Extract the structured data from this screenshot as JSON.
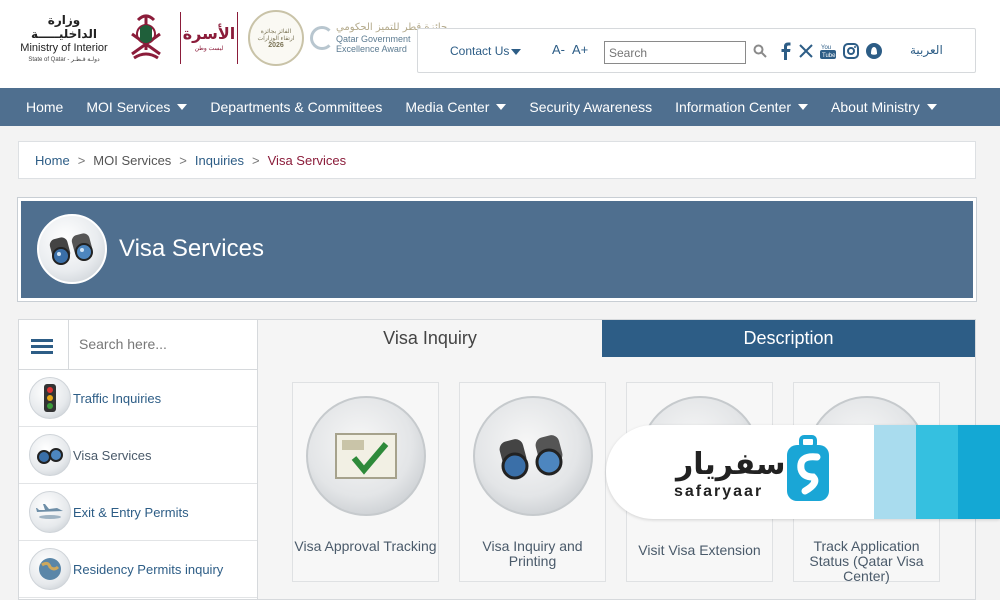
{
  "header": {
    "moi_arabic": "وزارة الداخليـــــة",
    "moi_english": "Ministry of Interior",
    "moi_state": "State of Qatar - دولـة قـطـر",
    "vision_arabic": "الأسرة",
    "vision_sub": "ليست وطن",
    "award_badge_line1": "الفائز بجائزة",
    "award_badge_line2": "ارتقاء الوزارات",
    "award_badge_year": "2026",
    "qgea_arabic": "جائزة قطر للتميز الحكومي",
    "qgea_english_1": "Qatar Government",
    "qgea_english_2": "Excellence Award"
  },
  "topbar": {
    "contact_label": "Contact Us",
    "font_decrease": "A-",
    "font_increase": "A+",
    "search_placeholder": "Search",
    "arabic_label": "العربية",
    "social_icons": [
      "facebook-icon",
      "x-icon",
      "youtube-icon",
      "instagram-icon",
      "snapchat-icon"
    ]
  },
  "nav": {
    "items": [
      {
        "label": "Home",
        "dropdown": false
      },
      {
        "label": "MOI Services",
        "dropdown": true
      },
      {
        "label": "Departments & Committees",
        "dropdown": false
      },
      {
        "label": "Media Center",
        "dropdown": true
      },
      {
        "label": "Security Awareness",
        "dropdown": false
      },
      {
        "label": "Information Center",
        "dropdown": true
      },
      {
        "label": "About Ministry",
        "dropdown": true
      }
    ]
  },
  "breadcrumb": {
    "home": "Home",
    "sep": ">",
    "moi_services": "MOI Services",
    "inquiries": "Inquiries",
    "current": "Visa Services"
  },
  "banner": {
    "title": "Visa Services",
    "icon": "binoculars-icon"
  },
  "sidebar": {
    "search_placeholder": "Search here...",
    "items": [
      {
        "label": "Traffic Inquiries",
        "icon": "traffic-light-icon"
      },
      {
        "label": "Visa Services",
        "icon": "binoculars-icon"
      },
      {
        "label": "Exit & Entry Permits",
        "icon": "airplane-icon"
      },
      {
        "label": "Residency Permits inquiry",
        "icon": "globe-icon"
      }
    ]
  },
  "tabs": {
    "left": "Visa Inquiry",
    "right": "Description"
  },
  "cards": [
    {
      "label": "Visa Approval Tracking",
      "icon": "checkmark-document-icon"
    },
    {
      "label": "Visa Inquiry and Printing",
      "icon": "binoculars-icon"
    },
    {
      "label": "Visit Visa Extension",
      "icon": "visa-extension-icon"
    },
    {
      "label": "Track Application Status (Qatar Visa Center)",
      "icon": "track-status-icon"
    }
  ],
  "ad": {
    "arabic": "سفريار",
    "english": "safaryaar",
    "colors": [
      "#a9dcee",
      "#35c0e0",
      "#14a8d4"
    ]
  },
  "colors": {
    "nav_bg": "#4f6f8f",
    "link_blue": "#2d5d86",
    "breadcrumb_current": "#8b1c3a",
    "tab_active": "#2d5d86"
  }
}
